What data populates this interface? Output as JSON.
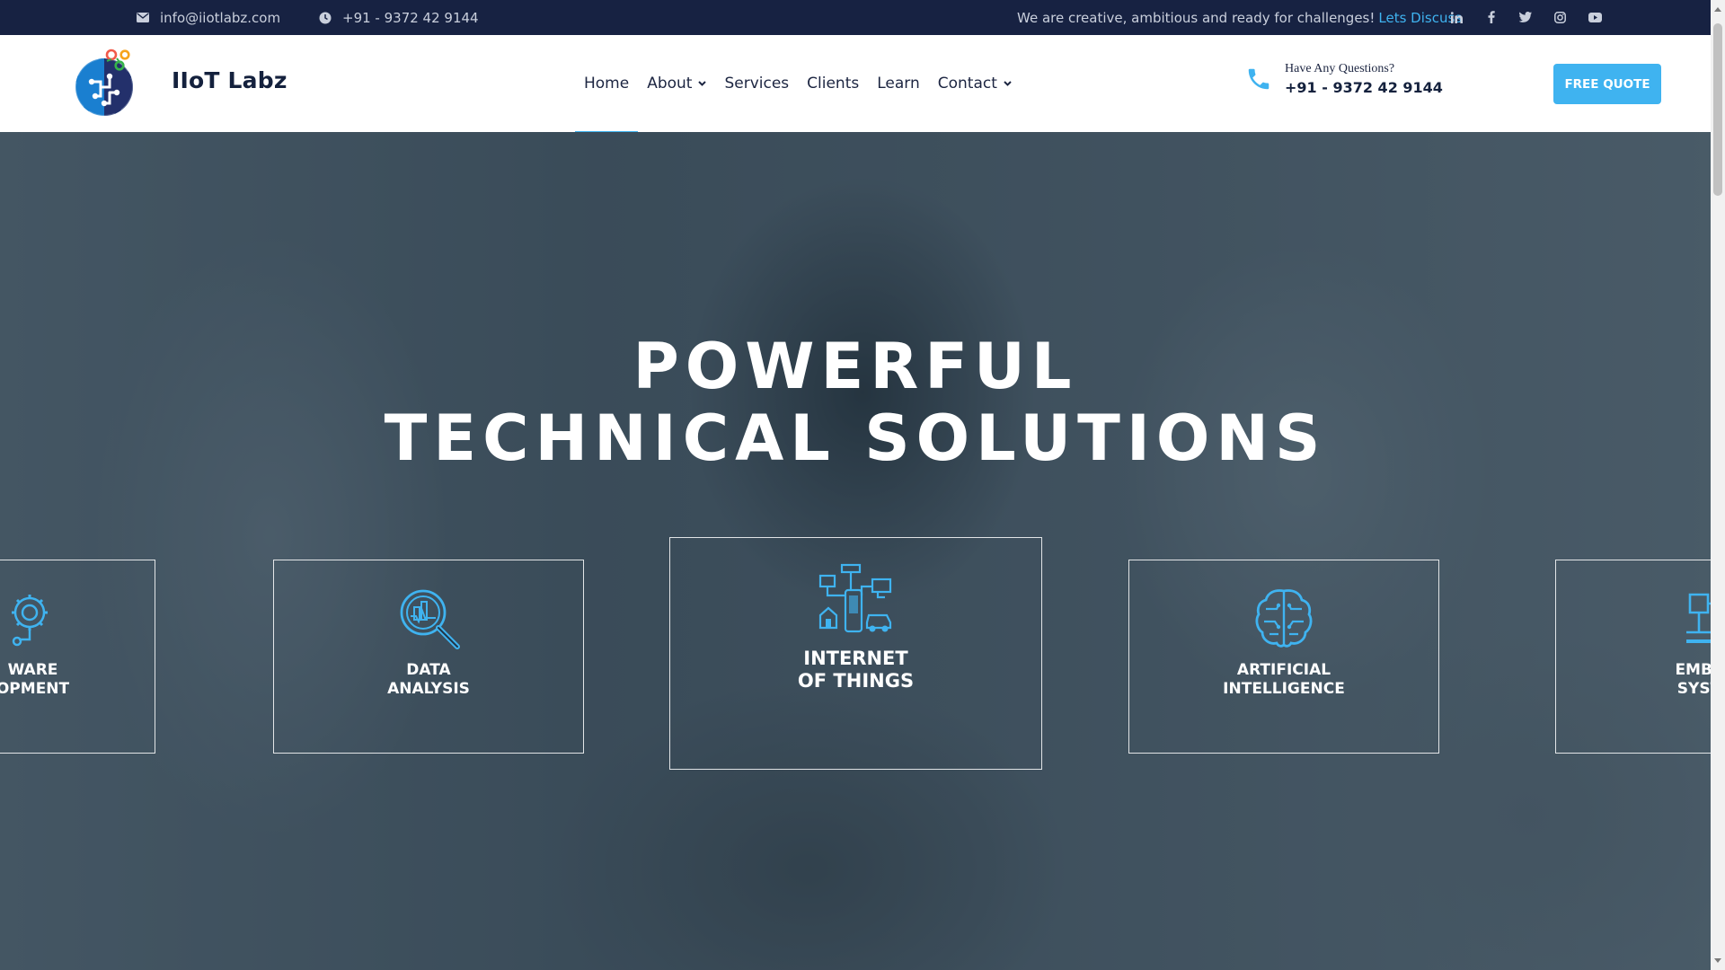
{
  "topbar": {
    "email": "info@iiotlabz.com",
    "phone": "+91 - 9372 42 9144",
    "tagline": "We are creative, ambitious and ready for challenges!",
    "tagline_link": "Lets Discuss",
    "social": [
      "linkedin-icon",
      "facebook-icon",
      "twitter-icon",
      "instagram-icon",
      "youtube-icon"
    ]
  },
  "header": {
    "brand": "IIoT Labz",
    "nav": [
      {
        "label": "Home",
        "active": true
      },
      {
        "label": "About",
        "dropdown": true
      },
      {
        "label": "Services"
      },
      {
        "label": "Clients"
      },
      {
        "label": "Learn"
      },
      {
        "label": "Contact",
        "dropdown": true
      }
    ],
    "question": "Have Any Questions?",
    "question_phone": "+91 - 9372 42 9144",
    "cta": "FREE QUOTE"
  },
  "hero": {
    "title_line1": "POWERFUL",
    "title_line2": "TECHNICAL SOLUTIONS",
    "cards": [
      {
        "line1": "WARE",
        "line2": "OPMENT",
        "icon": "gear-chip-icon"
      },
      {
        "line1": "DATA",
        "line2": "ANALYSIS",
        "icon": "data-analysis-icon"
      },
      {
        "line1": "INTERNET",
        "line2": "OF THINGS",
        "icon": "iot-devices-icon"
      },
      {
        "line1": "ARTIFICIAL",
        "line2": "INTELLIGENCE",
        "icon": "brain-icon"
      },
      {
        "line1": "EMBE",
        "line2": "SYST",
        "icon": "circuit-icon"
      }
    ]
  },
  "colors": {
    "accent": "#3fb3f0",
    "topbar": "#172242",
    "text_dark": "#14213d"
  }
}
